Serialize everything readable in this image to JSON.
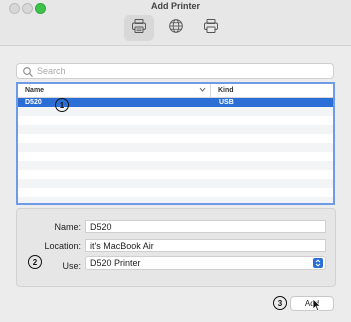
{
  "window": {
    "title": "Add Printer"
  },
  "toolbar": {
    "buttons": [
      {
        "name": "default",
        "icon": "printer-icon"
      },
      {
        "name": "ip",
        "icon": "globe-icon"
      },
      {
        "name": "windows",
        "icon": "printer-outline-icon"
      }
    ]
  },
  "search": {
    "placeholder": "Search",
    "value": ""
  },
  "table": {
    "columns": [
      "Name",
      "Kind"
    ],
    "rows": [
      {
        "name": "D520",
        "kind": "USB",
        "selected": true
      }
    ]
  },
  "form": {
    "name_label": "Name:",
    "name_value": "D520",
    "location_label": "Location:",
    "location_value": "it's MacBook Air",
    "use_label": "Use:",
    "use_value": "D520 Printer"
  },
  "annotations": [
    "1",
    "2",
    "3"
  ],
  "actions": {
    "add_label": "Add"
  },
  "colors": {
    "accent": "#2b6fd6",
    "focus_ring": "#6e9ae6"
  }
}
